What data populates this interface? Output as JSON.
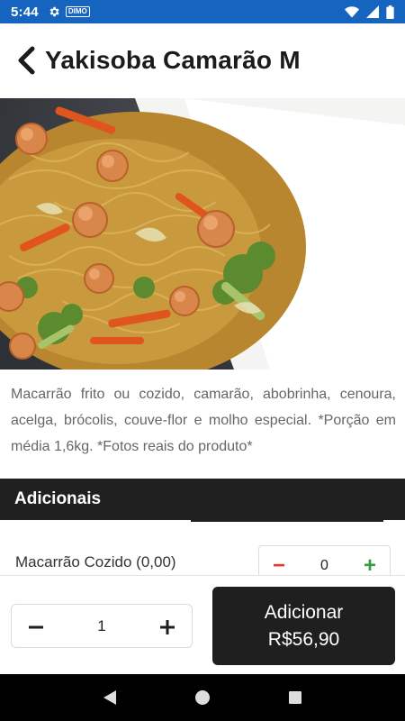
{
  "status_bar": {
    "time": "5:44",
    "app_badge": "DIMO",
    "icons": [
      "settings-icon",
      "wifi-icon",
      "signal-icon",
      "battery-icon"
    ],
    "background": "#1565c0"
  },
  "header": {
    "title": "Yakisoba Camarão M",
    "back_icon": "chevron-left-icon"
  },
  "product": {
    "image": "yakisoba-photo",
    "description": "Macarrão frito ou cozido, camarão, abobrinha, cenoura, acelga, brócolis, couve-flor e molho especial. *Porção em média 1,6kg. *Fotos reais do produto*"
  },
  "addons": {
    "title": "Adicionais",
    "items": [
      {
        "label": "Macarrão Cozido (0,00)",
        "quantity": "0",
        "minus": "−",
        "plus": "+"
      }
    ]
  },
  "order": {
    "quantity": "1",
    "minus_icon": "minus-icon",
    "plus_icon": "plus-icon",
    "add_label": "Adicionar",
    "price": "R$56,90"
  },
  "nav_bar": {
    "icons": [
      "back-triangle-icon",
      "home-circle-icon",
      "recents-square-icon"
    ]
  },
  "colors": {
    "accent_dark": "#1f1f1f",
    "minus_red": "#e53935",
    "plus_green": "#2e9e3e"
  }
}
